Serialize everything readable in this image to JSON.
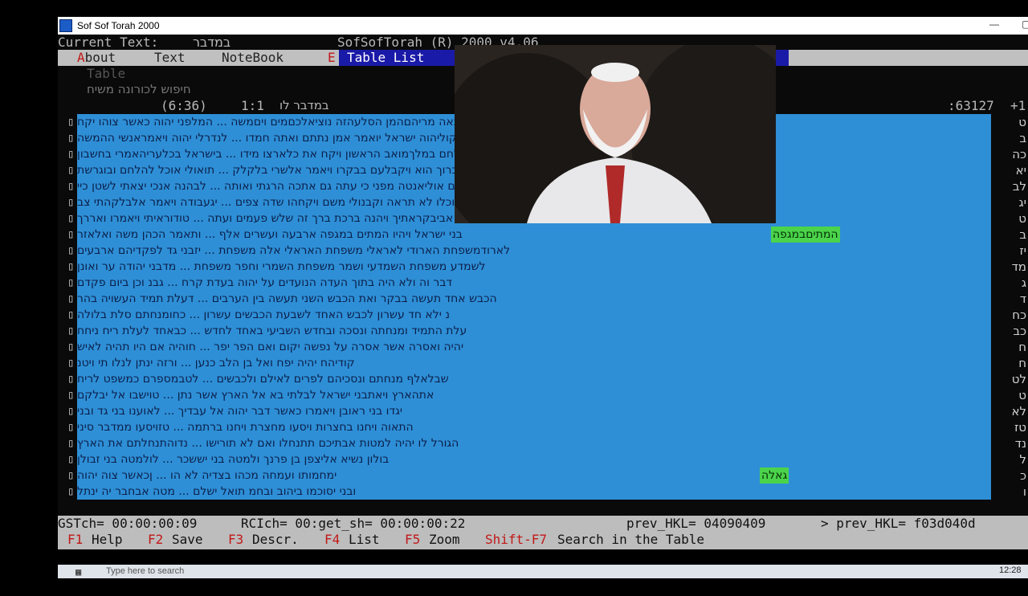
{
  "window": {
    "title": "Sof Sof Torah 2000"
  },
  "header": {
    "current_text_label": "Current Text:",
    "current_text_value": "במדבר",
    "version": "SofSofTorah (R) 2000 v4.06"
  },
  "menu": {
    "about": "About",
    "text": "Text",
    "notebook": "NoteBook",
    "e_trunc": "E",
    "table_list": "Table List"
  },
  "table_heading": {
    "table_word": "Table",
    "subtitle": "חיפוש לכורונה משיח",
    "position": "(6:36)",
    "verse": "1:1",
    "book_ref": "במדבר לו",
    "count": ":63127",
    "tail": "+1"
  },
  "grid": {
    "highlight_1": "המתיםבמגפה",
    "highlight_2": "גאלה",
    "row_labels": [
      "ט",
      "ב",
      "כה",
      "יא",
      "לב",
      "יג",
      "ט",
      "ב",
      "יז",
      "מד",
      "ג",
      "ד",
      "כח",
      "כב",
      "ח",
      "ח",
      "לט",
      "ט",
      "לא",
      "טז",
      "נד",
      "ל",
      "כ",
      "ו"
    ],
    "rows": [
      "מועד נאה מריהםהמן הסלעהזה נוציאלכםמים ויםמשה ... המלפני יהוה כאשר צוהו יקח",
      "הקוליהוה ישראל יואמר אמן נתתם ואתה חמדו ... לנדרלי יהוה ויאמראנשי ההמשה",
      "אהוא נלחם במלךמואב הראשון ויקח את כלארצו מידו ... בישראל בכלעריהאמרי בחשבון",
      "העטכיברוך הוא ויקבלעם בבקרו ויאמר אלשרי בלקלק ... תואולי אוכל להלחם ובוגרשת",
      "גלים אוליאנטה מפני כי עתה גם אתכה הרגתי ואותה ... לבהנה אנכי יצאתי לשטן כיי",
      "אהוכלו לא תראה וקבנולי משם ויקחהו שדה צפים ... יגעבודה ויאמר אלבלקהתי צב",
      "אביבקראתיך ויהנה ברכת ברך זה שלש פעמים ועתה ... טודוראיתי ויאמרו ואררך",
      "בני ישראל ויהיו המתים במגפה ארבעה ועשרים אלף ... ותאמר הכהן משה ואלאזר",
      "לארודמשפחת הארודי לאראלי משפחת האראלי אלה משפחת ... יזבני גד לפקדיהם ארבעים",
      "לשמדע משפחת השמדעי ושמר משפחת השמרי וחפר משפחת ... מדבני יהודה ער ואונן",
      "דבר וה ולא היה בתוך העדה הנועדים על יהוה בעדת קרח ... גבנ וכן ביום פקדם",
      "הכבש אחד תעשה בבקר ואת הכבש השני תעשה בין הערבים ... דעלת תמיד העשויה בהר",
      "נ ילא חד עשרון לכבש האחד לשבעת הכבשים עשרון ... כחומנחתם סלת בלולה",
      "עלת התמיד ומנחתה ונסכה ובחדש השביעי באחד לחדש ... כבאחד לעלת ריח ניחח",
      "יהיה ואסרה אשר אסרה על נפשה יקום ואם הפר יפר ... חוהיה אם היו תהיה לאיש",
      "קודיהח יהיה יפח ואל בן הלב כנען ... ורזה ינתן לנלו תי ויטנ",
      "שבלאלף מנחתם ונסכיהם לפרים לאילם ולכבשים ... לטבמספרם כמשפט לריח",
      "אתהארץ ויאתבני ישראל לבלתי בא אל הארץ אשר נתן ... טוישבו אל יבלקם",
      "יגדו בני ראובן ויאמרו כאשר דבר יהוה אל עבדיך ... לאוענו בני גד ובני",
      "התאוה ויחנו בחצרות ויסעו מחצרת ויחנו ברתמה ... טזויסעו ממדבר סיני",
      "הגורל לו יהיה למטות אבתיכם תתנחלו ואם לא תורישו ... נדוהתנחלתם את הארץ",
      "בולון נשיא אליצפן בן פרנך ולמטה בני יששכר ... לולמטה בני זבולן",
      "ימחמותו ועמחה מכהו בצדיה לא הו ... ןכאשר צוה יהוה",
      "ובני יסוכמו ביהוב ובחמ תואל ישלם ... מטה אבחבר יה ינתל"
    ]
  },
  "status": {
    "gst": "GSTch= 00:00:00:09",
    "rci": "RCIch= 00:get_sh= 00:00:00:22",
    "prev1": "prev_HKL= 04090409",
    "prev2": "> prev_HKL= f03d040d"
  },
  "fkeys": [
    {
      "key": "F1",
      "label": "Help"
    },
    {
      "key": "F2",
      "label": "Save"
    },
    {
      "key": "F3",
      "label": "Descr."
    },
    {
      "key": "F4",
      "label": "List"
    },
    {
      "key": "F5",
      "label": "Zoom"
    },
    {
      "key": "Shift-F7",
      "label": "Search in the Table"
    }
  ],
  "taskbar": {
    "search_placeholder": "Type here to search",
    "time": "12:28"
  }
}
